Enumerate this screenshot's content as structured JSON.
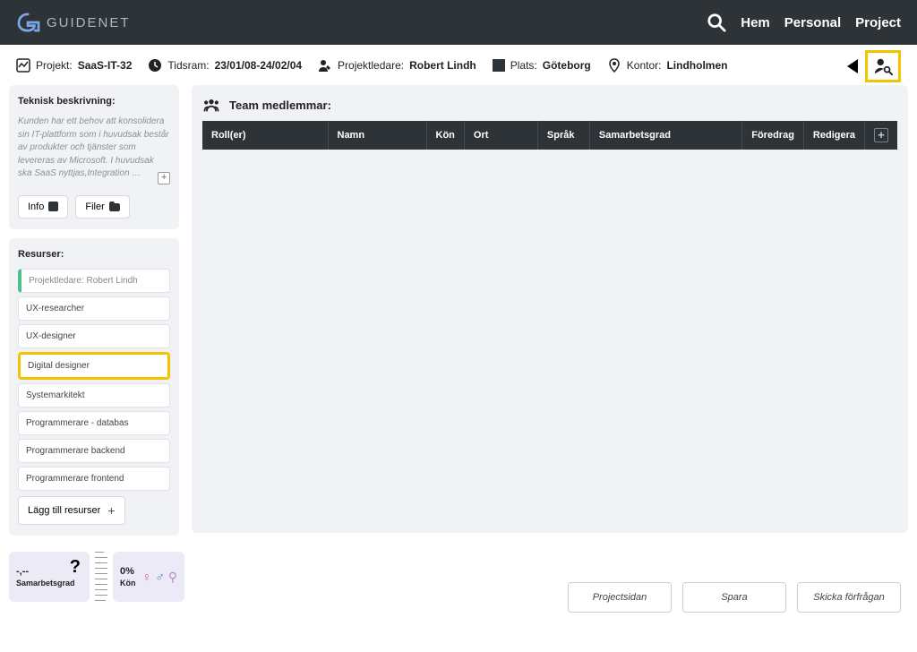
{
  "brand": "GUIDENET",
  "nav": {
    "hem": "Hem",
    "personal": "Personal",
    "project": "Project"
  },
  "info": {
    "projekt_label": "Projekt:",
    "projekt_val": "SaaS-IT-32",
    "tidsram_label": "Tidsram:",
    "tidsram_val": "23/01/08-24/02/04",
    "ledare_label": "Projektledare:",
    "ledare_val": "Robert Lindh",
    "plats_label": "Plats:",
    "plats_val": "Göteborg",
    "kontor_label": "Kontor:",
    "kontor_val": "Lindholmen"
  },
  "left": {
    "teknisk_title": "Teknisk beskrivning:",
    "teknisk_text": "Kunden har ett behov att konsolidera sin IT-plattform som i huvudsak består av produkter och tjänster som levereras av Microsoft. I huvudsak ska SaaS nyttjas,Integration …",
    "info_btn": "Info",
    "filer_btn": "Filer",
    "resurser_title": "Resurser:",
    "resources": [
      "Projektledare: Robert Lindh",
      "UX-researcher",
      "UX-designer",
      "Digital designer",
      "Systemarkitekt",
      "Programmerare - databas",
      "Programmerare backend",
      "Programmerare frontend"
    ],
    "add_res": "Lägg till resurser"
  },
  "team": {
    "title": "Team medlemmar:",
    "columns": [
      "Roll(er)",
      "Namn",
      "Kön",
      "Ort",
      "Språk",
      "Samarbetsgrad",
      "Föredrag",
      "Redigera"
    ]
  },
  "stats": {
    "grade_val": "-,--",
    "grade_label": "Samarbetsgrad",
    "gender_val": "0%",
    "gender_label": "Kön"
  },
  "footer": {
    "projectsidan": "Projectsidan",
    "spara": "Spara",
    "skicka": "Skicka förfrågan"
  }
}
